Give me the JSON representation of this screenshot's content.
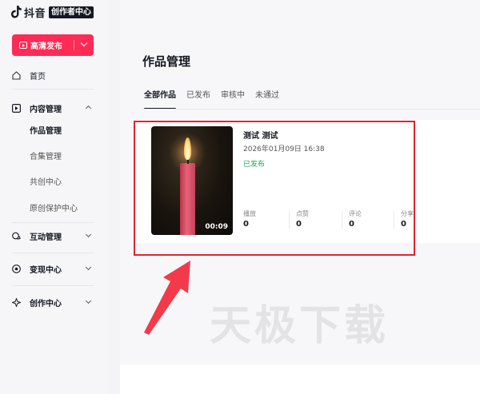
{
  "brand": {
    "name": "抖音",
    "badge": "创作者中心"
  },
  "sidebar": {
    "publish_label": "高清发布",
    "items": [
      {
        "label": "首页"
      },
      {
        "label": "内容管理"
      },
      {
        "label": "互动管理"
      },
      {
        "label": "变现中心"
      },
      {
        "label": "创作中心"
      }
    ],
    "content_sub": [
      {
        "label": "作品管理"
      },
      {
        "label": "合集管理"
      },
      {
        "label": "共创中心"
      },
      {
        "label": "原创保护中心"
      }
    ]
  },
  "main": {
    "title": "作品管理",
    "tabs": [
      {
        "label": "全部作品"
      },
      {
        "label": "已发布"
      },
      {
        "label": "审核中"
      },
      {
        "label": "未通过"
      }
    ],
    "work": {
      "title": "测试 测试",
      "date": "2026年01月09日 16:38",
      "status": "已发布",
      "duration": "00:09",
      "stats": [
        {
          "label": "播放",
          "value": "0"
        },
        {
          "label": "点赞",
          "value": "0"
        },
        {
          "label": "评论",
          "value": "0"
        },
        {
          "label": "分享",
          "value": "0"
        }
      ]
    }
  },
  "watermark": "天极下载",
  "colors": {
    "accent": "#fe2c55",
    "highlight": "#e0242f",
    "status_green": "#22a854"
  },
  "icons": [
    "tiktok-logo-icon",
    "video-play-icon",
    "chevron-down-icon",
    "home-icon",
    "content-icon",
    "chevron-up-icon",
    "interaction-icon",
    "monetize-icon",
    "creation-icon",
    "annotation-arrow-icon"
  ]
}
